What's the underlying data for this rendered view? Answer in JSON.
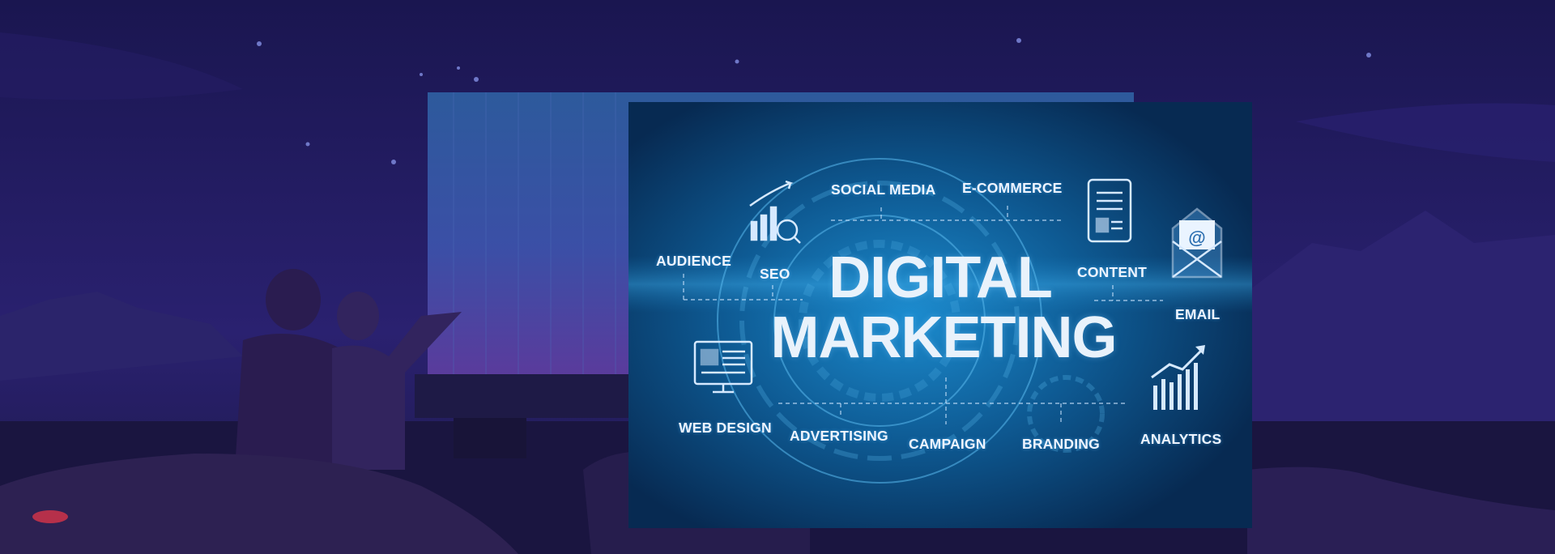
{
  "panel": {
    "title_line1": "DIGITAL",
    "title_line2": "MARKETING",
    "topics": {
      "social_media": "SOCIAL MEDIA",
      "ecommerce": "E-COMMERCE",
      "audience": "AUDIENCE",
      "seo": "SEO",
      "content": "CONTENT",
      "email": "EMAIL",
      "web_design": "WEB DESIGN",
      "advertising": "ADVERTISING",
      "campaign": "CAMPAIGN",
      "branding": "BRANDING",
      "analytics": "ANALYTICS"
    }
  },
  "colors": {
    "sky": "#1d1a57",
    "screen": "#2f4f9a",
    "panel_bg": "#0b4d7c",
    "label": "#eef4ff"
  }
}
